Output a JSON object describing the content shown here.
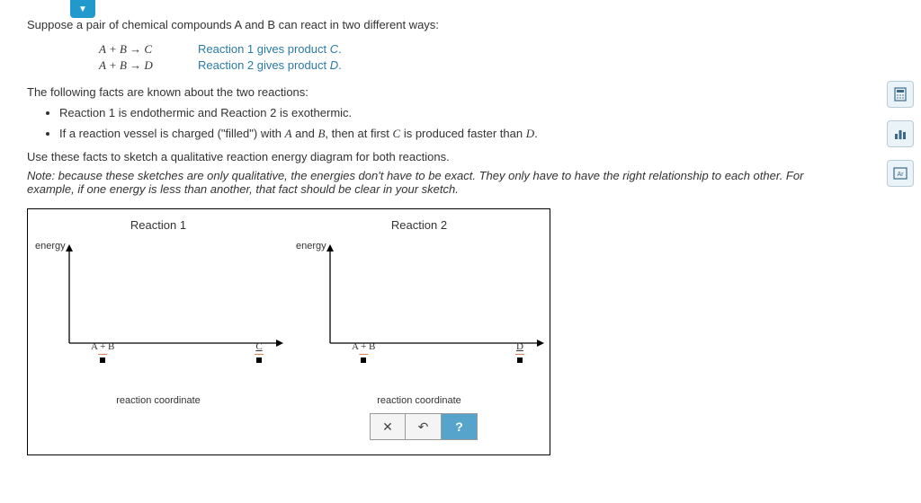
{
  "intro": "Suppose a pair of chemical compounds A and B can react in two different ways:",
  "eq1_lhs": "A + B → C",
  "eq1_desc_pre": "Reaction 1 gives product ",
  "eq1_desc_var": "C",
  "eq1_desc_post": ".",
  "eq2_lhs": "A + B → D",
  "eq2_desc_pre": "Reaction 2 gives product ",
  "eq2_desc_var": "D",
  "eq2_desc_post": ".",
  "facts_intro": "The following facts are known about the two reactions:",
  "bullet1": "Reaction 1 is endothermic and Reaction 2 is exothermic.",
  "bullet2_a": "If a reaction vessel is charged (\"filled\") with ",
  "bullet2_A": "A",
  "bullet2_b": " and ",
  "bullet2_B": "B",
  "bullet2_c": ", then at first ",
  "bullet2_C": "C",
  "bullet2_d": " is produced faster than ",
  "bullet2_D": "D",
  "bullet2_e": ".",
  "use_facts": "Use these facts to sketch a qualitative reaction energy diagram for both reactions.",
  "note": "Note: because these sketches are only qualitative, the energies don't have to be exact. They only have to have the right relationship to each other. For example, if one energy is less than another, that fact should be clear in your sketch.",
  "r1_title": "Reaction 1",
  "r2_title": "Reaction 2",
  "y_label": "energy",
  "x_label": "reaction coordinate",
  "tick_ab": "A + B",
  "tick_c": "C",
  "tick_d": "D",
  "btn_close": "✕",
  "btn_undo": "↶",
  "btn_help": "?"
}
